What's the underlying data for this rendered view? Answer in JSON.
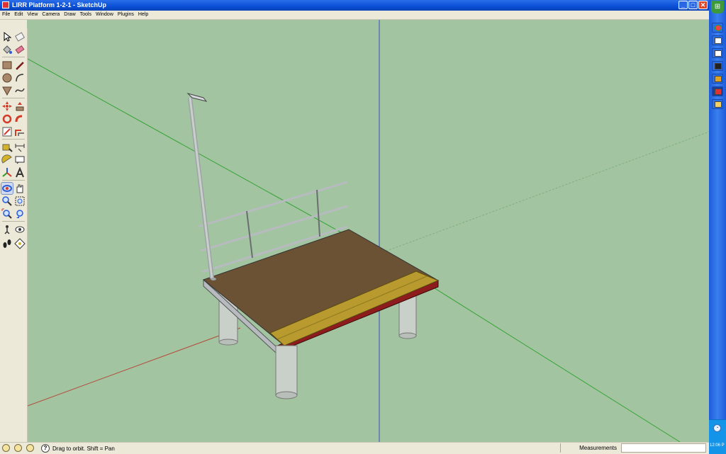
{
  "window": {
    "title": "LIRR Platform 1-2-1 - SketchUp",
    "buttons": {
      "minimize": "_",
      "maximize": "□",
      "close": "✕"
    }
  },
  "menu": [
    "File",
    "Edit",
    "View",
    "Camera",
    "Draw",
    "Tools",
    "Window",
    "Plugins",
    "Help"
  ],
  "toolbar": {
    "tools": [
      "select-icon",
      "eraser-icon",
      "paint-bucket-icon",
      "eraser-alt-icon",
      "rectangle-icon",
      "pencil-icon",
      "circle-icon",
      "arc-icon",
      "polygon-icon",
      "freehand-icon",
      "move-icon",
      "push-pull-icon",
      "rotate-icon",
      "follow-me-icon",
      "scale-icon",
      "offset-icon",
      "tape-measure-icon",
      "dimension-icon",
      "protractor-icon",
      "text-icon",
      "axes-icon",
      "3d-text-icon",
      "orbit-icon",
      "pan-icon",
      "zoom-icon",
      "zoom-window-icon",
      "zoom-extents-icon",
      "previous-view-icon",
      "position-camera-icon",
      "look-around-icon",
      "walk-icon",
      "section-plane-icon"
    ],
    "active_tool": "orbit-icon"
  },
  "status": {
    "text": "Drag to orbit.  Shift = Pan",
    "measurements_label": "Measurements",
    "measurements_value": ""
  },
  "taskbar": {
    "start": "⊞",
    "clock": "12:06 P"
  },
  "colors": {
    "sky_ground": "#a3c4a1",
    "platform_top": "#6b5234",
    "tactile_strip": "#b89a2e",
    "edge": "#8f1c1c",
    "concrete": "#c9cfc9",
    "rail": "#b7bbc0"
  }
}
